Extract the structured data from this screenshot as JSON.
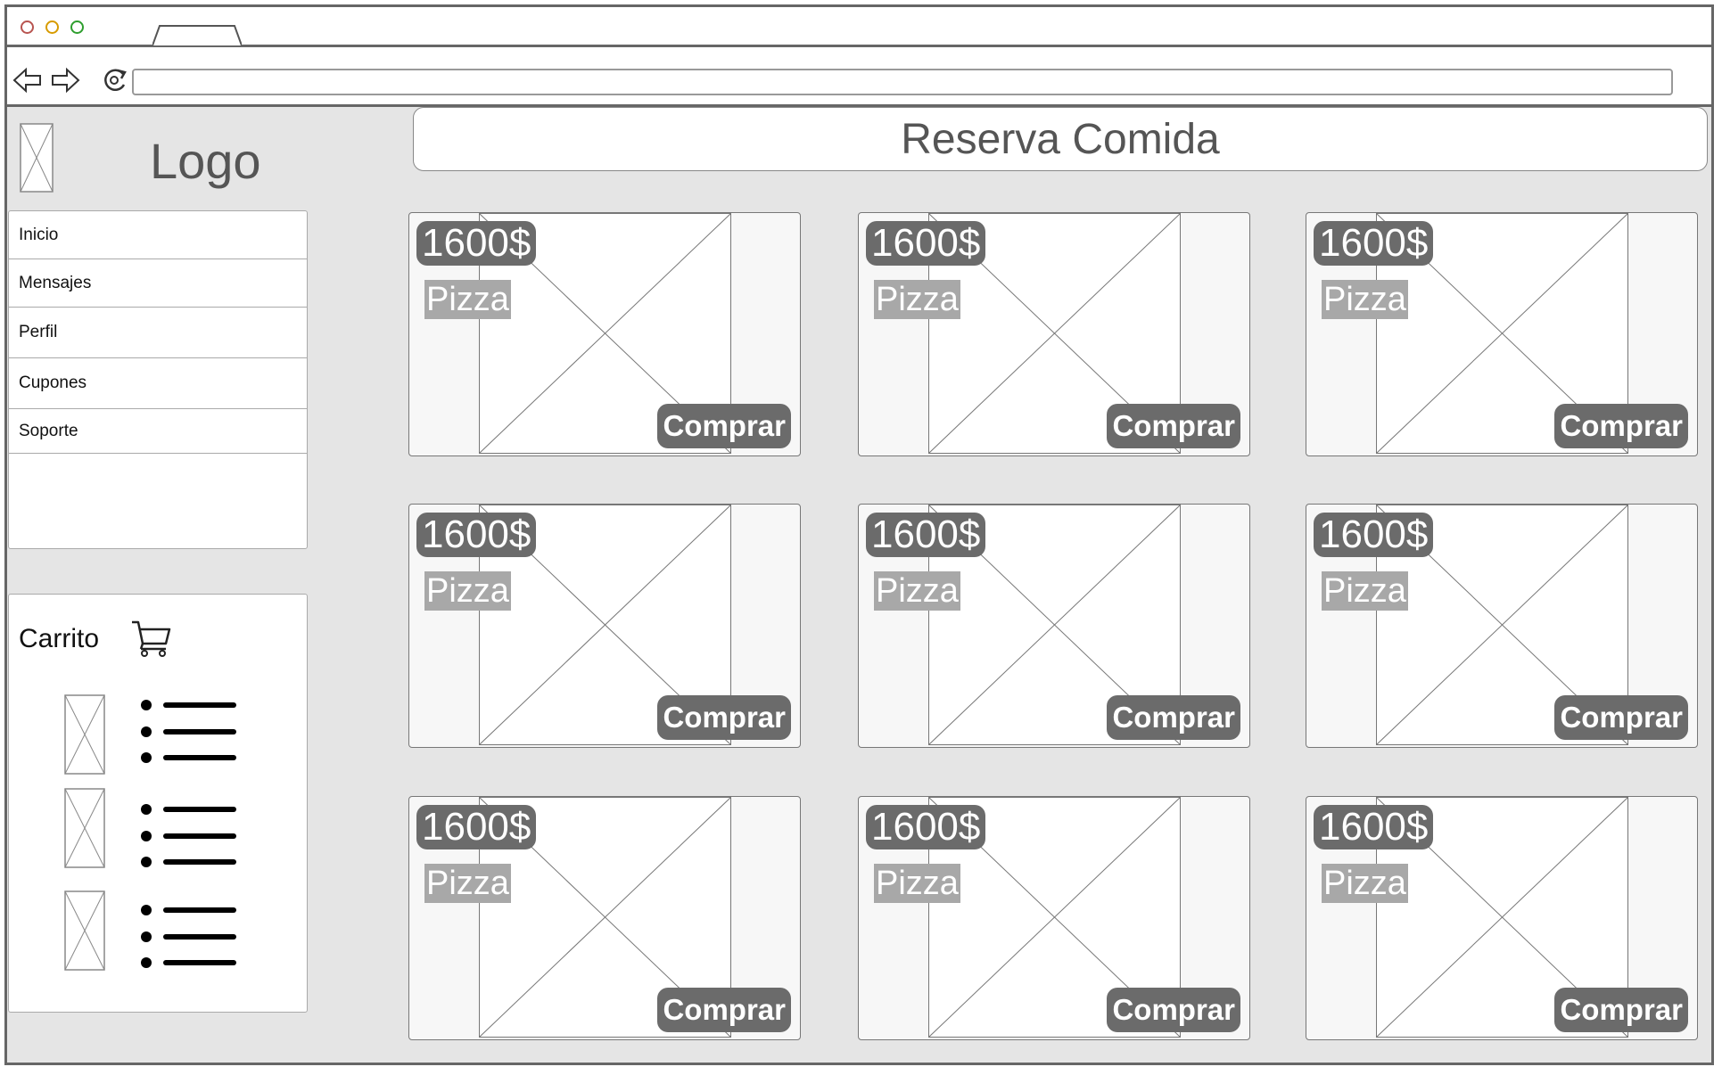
{
  "browser": {
    "url": ""
  },
  "sidebar": {
    "logo_label": "Logo",
    "menu": [
      {
        "label": "Inicio"
      },
      {
        "label": "Mensajes"
      },
      {
        "label": "Perfil"
      },
      {
        "label": "Cupones"
      },
      {
        "label": "Soporte"
      }
    ],
    "cart": {
      "title": "Carrito",
      "icon": "cart-icon",
      "item_count": 3
    }
  },
  "main": {
    "title": "Reserva Comida",
    "products": [
      {
        "price": "1600$",
        "name": "Pizza",
        "button": "Comprar"
      },
      {
        "price": "1600$",
        "name": "Pizza",
        "button": "Comprar"
      },
      {
        "price": "1600$",
        "name": "Pizza",
        "button": "Comprar"
      },
      {
        "price": "1600$",
        "name": "Pizza",
        "button": "Comprar"
      },
      {
        "price": "1600$",
        "name": "Pizza",
        "button": "Comprar"
      },
      {
        "price": "1600$",
        "name": "Pizza",
        "button": "Comprar"
      },
      {
        "price": "1600$",
        "name": "Pizza",
        "button": "Comprar"
      },
      {
        "price": "1600$",
        "name": "Pizza",
        "button": "Comprar"
      },
      {
        "price": "1600$",
        "name": "Pizza",
        "button": "Comprar"
      }
    ]
  },
  "colors": {
    "close": "#b85450",
    "minimize": "#d79b00",
    "maximize": "#2e9e2e",
    "badge": "#6b6b6b",
    "name_badge": "#a8a8a8"
  }
}
